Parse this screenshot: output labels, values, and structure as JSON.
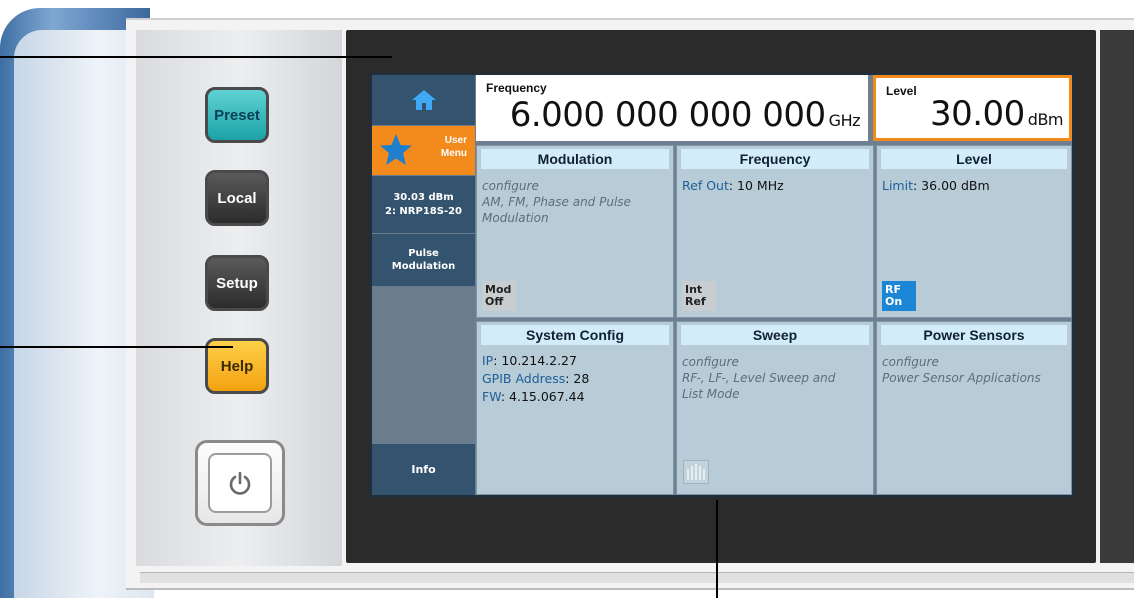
{
  "hardware_keys": {
    "preset": "Preset",
    "local": "Local",
    "setup": "Setup",
    "help": "Help",
    "power_icon": "power-icon"
  },
  "sidebar": {
    "home_icon": "home-icon",
    "user_menu": [
      "User",
      "Menu"
    ],
    "user_menu_icon": "star-icon",
    "sensor_reading": [
      "30.03 dBm",
      "2: NRP18S-20"
    ],
    "pulse": [
      "Pulse",
      "Modulation"
    ],
    "info": "Info"
  },
  "header": {
    "frequency": {
      "label": "Frequency",
      "value": "6.000 000 000 000",
      "unit": "GHz"
    },
    "level": {
      "label": "Level",
      "value": "30.00",
      "unit": "dBm"
    }
  },
  "tiles": {
    "modulation": {
      "title": "Modulation",
      "lines": [
        "configure",
        "AM, FM, Phase and Pulse",
        "Modulation"
      ],
      "badge": [
        "Mod",
        "Off"
      ]
    },
    "frequency": {
      "title": "Frequency",
      "key": "Ref Out",
      "value": ": 10 MHz",
      "badge": [
        "Int",
        "Ref"
      ]
    },
    "level": {
      "title": "Level",
      "key": "Limit",
      "value": ": 36.00 dBm",
      "badge": [
        "RF",
        "On"
      ]
    },
    "system_config": {
      "title": "System Config",
      "rows": [
        {
          "key": "IP",
          "value": ": 10.214.2.27"
        },
        {
          "key": "GPIB Address",
          "value": ": 28"
        },
        {
          "key": "FW",
          "value": ": 4.15.067.44"
        }
      ]
    },
    "sweep": {
      "title": "Sweep",
      "lines": [
        "configure",
        "RF-, LF-, Level Sweep and",
        "List Mode"
      ],
      "icon": "sweep-icon"
    },
    "power_sensors": {
      "title": "Power Sensors",
      "lines": [
        "configure",
        "Power Sensor Applications"
      ]
    }
  },
  "colors": {
    "accent_orange": "#f28a1c",
    "tile_bg": "#b8ccd8",
    "tile_header": "#d3ecfa",
    "sidebar_dark": "#33536e",
    "rf_on_blue": "#1c86d6"
  }
}
